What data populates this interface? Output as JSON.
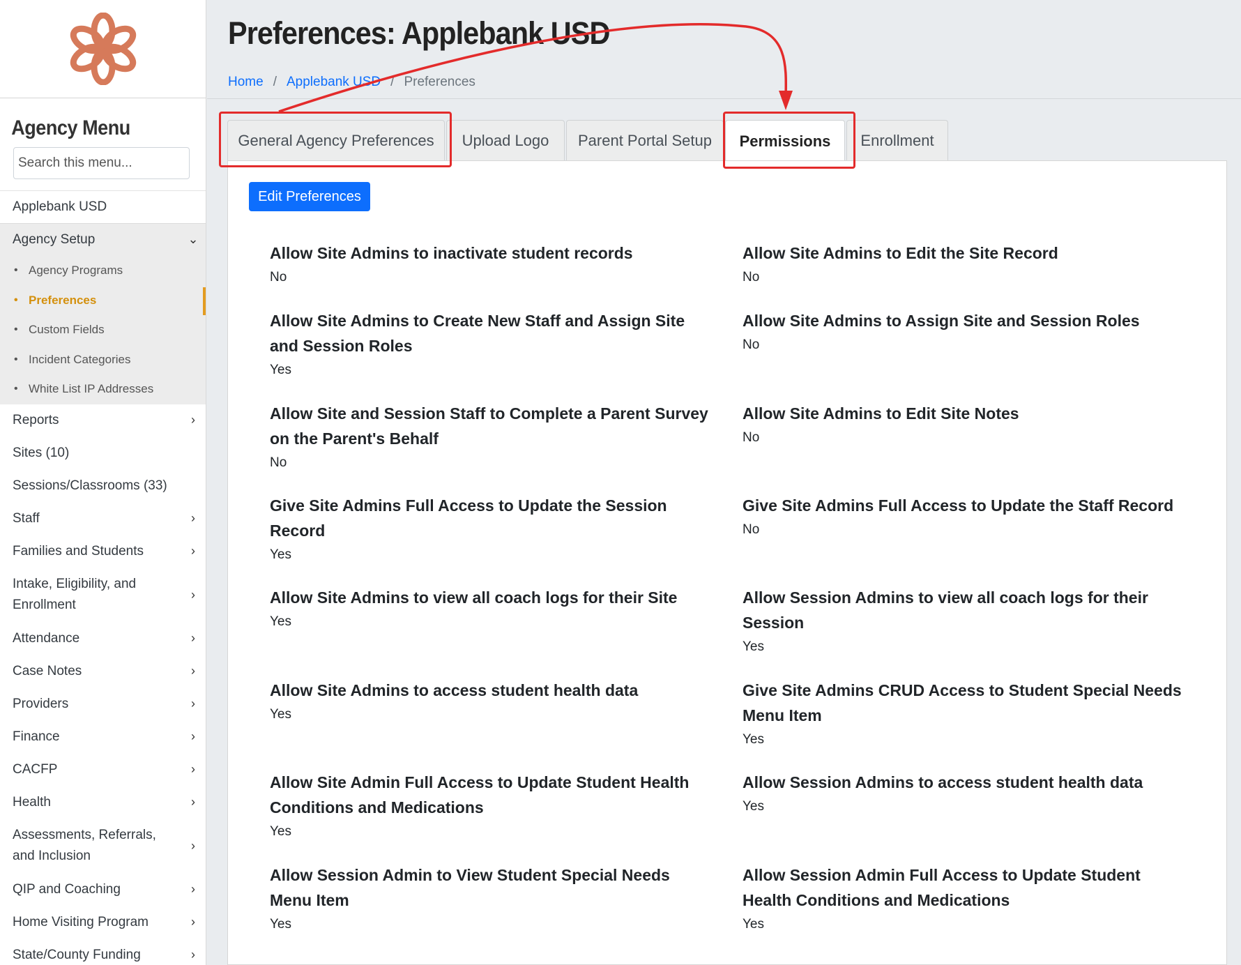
{
  "sidebar": {
    "menu_title": "Agency Menu",
    "search_placeholder": "Search this menu...",
    "agency_name": "Applebank USD",
    "group_label": "Agency Setup",
    "sub_items": [
      "Agency Programs",
      "Preferences",
      "Custom Fields",
      "Incident Categories",
      "White List IP Addresses"
    ],
    "active_sub_item": "Preferences",
    "items": [
      "Reports",
      "Sites (10)",
      "Sessions/Classrooms (33)",
      "Staff",
      "Families and Students",
      "Intake, Eligibility, and Enrollment",
      "Attendance",
      "Case Notes",
      "Providers",
      "Finance",
      "CACFP",
      "Health",
      "Assessments, Referrals, and Inclusion",
      "QIP and Coaching",
      "Home Visiting Program",
      "State/County Funding"
    ],
    "logo_color": "#d67a5a",
    "active_color": "#d4900d"
  },
  "header": {
    "title": "Preferences: Applebank USD",
    "breadcrumb": [
      "Home",
      "Applebank USD",
      "Preferences"
    ]
  },
  "tabs": [
    "General Agency Preferences",
    "Upload Logo",
    "Parent Portal Setup",
    "Permissions",
    "Enrollment"
  ],
  "active_tab": "Permissions",
  "edit_button_label": "Edit Preferences",
  "preferences": [
    {
      "label": "Allow Site Admins to inactivate student records",
      "value": "No"
    },
    {
      "label": "Allow Site Admins to Edit the Site Record",
      "value": "No"
    },
    {
      "label": "Allow Site Admins to Create New Staff and Assign Site and Session Roles",
      "value": "Yes"
    },
    {
      "label": "Allow Site Admins to Assign Site and Session Roles",
      "value": "No"
    },
    {
      "label": "Allow Site and Session Staff to Complete a Parent Survey on the Parent's Behalf",
      "value": "No"
    },
    {
      "label": "Allow Site Admins to Edit Site Notes",
      "value": "No"
    },
    {
      "label": "Give Site Admins Full Access to Update the Session Record",
      "value": "Yes"
    },
    {
      "label": "Give Site Admins Full Access to Update the Staff Record",
      "value": "No"
    },
    {
      "label": "Allow Site Admins to view all coach logs for their Site",
      "value": "Yes"
    },
    {
      "label": "Allow Session Admins to view all coach logs for their Session",
      "value": "Yes"
    },
    {
      "label": "Allow Site Admins to access student health data",
      "value": "Yes"
    },
    {
      "label": "Give Site Admins CRUD Access to Student Special Needs Menu Item",
      "value": "Yes"
    },
    {
      "label": "Allow Site Admin Full Access to Update Student Health Conditions and Medications",
      "value": "Yes"
    },
    {
      "label": "Allow Session Admins to access student health data",
      "value": "Yes"
    },
    {
      "label": "Allow Session Admin to View Student Special Needs Menu Item",
      "value": "Yes"
    },
    {
      "label": "Allow Session Admin Full Access to Update Student Health Conditions and Medications",
      "value": "Yes"
    }
  ],
  "colors": {
    "primary": "#0d6efd",
    "annotation": "#e32b2b"
  }
}
